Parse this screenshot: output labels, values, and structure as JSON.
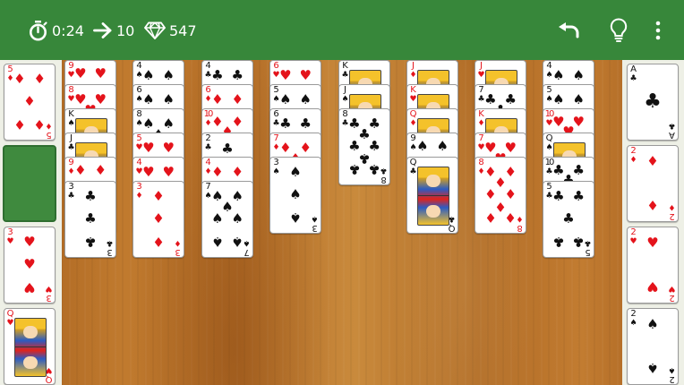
{
  "stats": {
    "time": "0:24",
    "moves": "10",
    "score": "547"
  },
  "toolbar": {
    "undo_icon": "undo-icon",
    "hint_icon": "lightbulb-icon",
    "menu_icon": "more-vertical-icon"
  },
  "colors": {
    "topbar": "#37873a",
    "table": "#b8722a",
    "slot": "#3f8a3e",
    "red": "#e4131b",
    "black": "#111111"
  },
  "reserve": [
    {
      "rank": "5",
      "suit": "♦",
      "color": "red"
    },
    {
      "empty": true
    },
    {
      "rank": "3",
      "suit": "♥",
      "color": "red"
    },
    {
      "rank": "Q",
      "suit": "♥",
      "color": "red",
      "face": true
    }
  ],
  "tableau": [
    [
      {
        "rank": "9",
        "suit": "♥",
        "color": "red"
      },
      {
        "rank": "8",
        "suit": "♥",
        "color": "red"
      },
      {
        "rank": "K",
        "suit": "♠",
        "color": "black",
        "face": true
      },
      {
        "rank": "J",
        "suit": "♣",
        "color": "black",
        "face": true
      },
      {
        "rank": "9",
        "suit": "♦",
        "color": "red"
      },
      {
        "rank": "3",
        "suit": "♣",
        "color": "black"
      }
    ],
    [
      {
        "rank": "4",
        "suit": "♠",
        "color": "black"
      },
      {
        "rank": "6",
        "suit": "♠",
        "color": "black"
      },
      {
        "rank": "8",
        "suit": "♠",
        "color": "black"
      },
      {
        "rank": "5",
        "suit": "♥",
        "color": "red"
      },
      {
        "rank": "4",
        "suit": "♥",
        "color": "red"
      },
      {
        "rank": "3",
        "suit": "♦",
        "color": "red"
      }
    ],
    [
      {
        "rank": "4",
        "suit": "♣",
        "color": "black"
      },
      {
        "rank": "6",
        "suit": "♦",
        "color": "red"
      },
      {
        "rank": "10",
        "suit": "♦",
        "color": "red"
      },
      {
        "rank": "2",
        "suit": "♣",
        "color": "black"
      },
      {
        "rank": "4",
        "suit": "♦",
        "color": "red"
      },
      {
        "rank": "7",
        "suit": "♠",
        "color": "black"
      }
    ],
    [
      {
        "rank": "6",
        "suit": "♥",
        "color": "red"
      },
      {
        "rank": "5",
        "suit": "♠",
        "color": "black"
      },
      {
        "rank": "6",
        "suit": "♣",
        "color": "black"
      },
      {
        "rank": "7",
        "suit": "♦",
        "color": "red"
      },
      {
        "rank": "3",
        "suit": "♠",
        "color": "black"
      }
    ],
    [
      {
        "rank": "K",
        "suit": "♣",
        "color": "black",
        "face": true
      },
      {
        "rank": "J",
        "suit": "♠",
        "color": "black",
        "face": true
      },
      {
        "rank": "8",
        "suit": "♣",
        "color": "black"
      }
    ],
    [
      {
        "rank": "J",
        "suit": "♦",
        "color": "red",
        "face": true
      },
      {
        "rank": "K",
        "suit": "♥",
        "color": "red",
        "face": true
      },
      {
        "rank": "Q",
        "suit": "♦",
        "color": "red",
        "face": true
      },
      {
        "rank": "9",
        "suit": "♠",
        "color": "black"
      },
      {
        "rank": "Q",
        "suit": "♣",
        "color": "black",
        "face": true
      }
    ],
    [
      {
        "rank": "J",
        "suit": "♥",
        "color": "red",
        "face": true
      },
      {
        "rank": "7",
        "suit": "♣",
        "color": "black"
      },
      {
        "rank": "K",
        "suit": "♦",
        "color": "red",
        "face": true
      },
      {
        "rank": "7",
        "suit": "♥",
        "color": "red"
      },
      {
        "rank": "8",
        "suit": "♦",
        "color": "red"
      }
    ],
    [
      {
        "rank": "4",
        "suit": "♠",
        "color": "black"
      },
      {
        "rank": "5",
        "suit": "♠",
        "color": "black"
      },
      {
        "rank": "10",
        "suit": "♥",
        "color": "red"
      },
      {
        "rank": "Q",
        "suit": "♠",
        "color": "black",
        "face": true
      },
      {
        "rank": "10",
        "suit": "♣",
        "color": "black"
      },
      {
        "rank": "5",
        "suit": "♣",
        "color": "black"
      }
    ]
  ],
  "foundations": [
    {
      "rank": "A",
      "suit": "♣",
      "color": "black"
    },
    {
      "rank": "2",
      "suit": "♦",
      "color": "red"
    },
    {
      "rank": "2",
      "suit": "♥",
      "color": "red"
    },
    {
      "rank": "2",
      "suit": "♠",
      "color": "black"
    }
  ]
}
